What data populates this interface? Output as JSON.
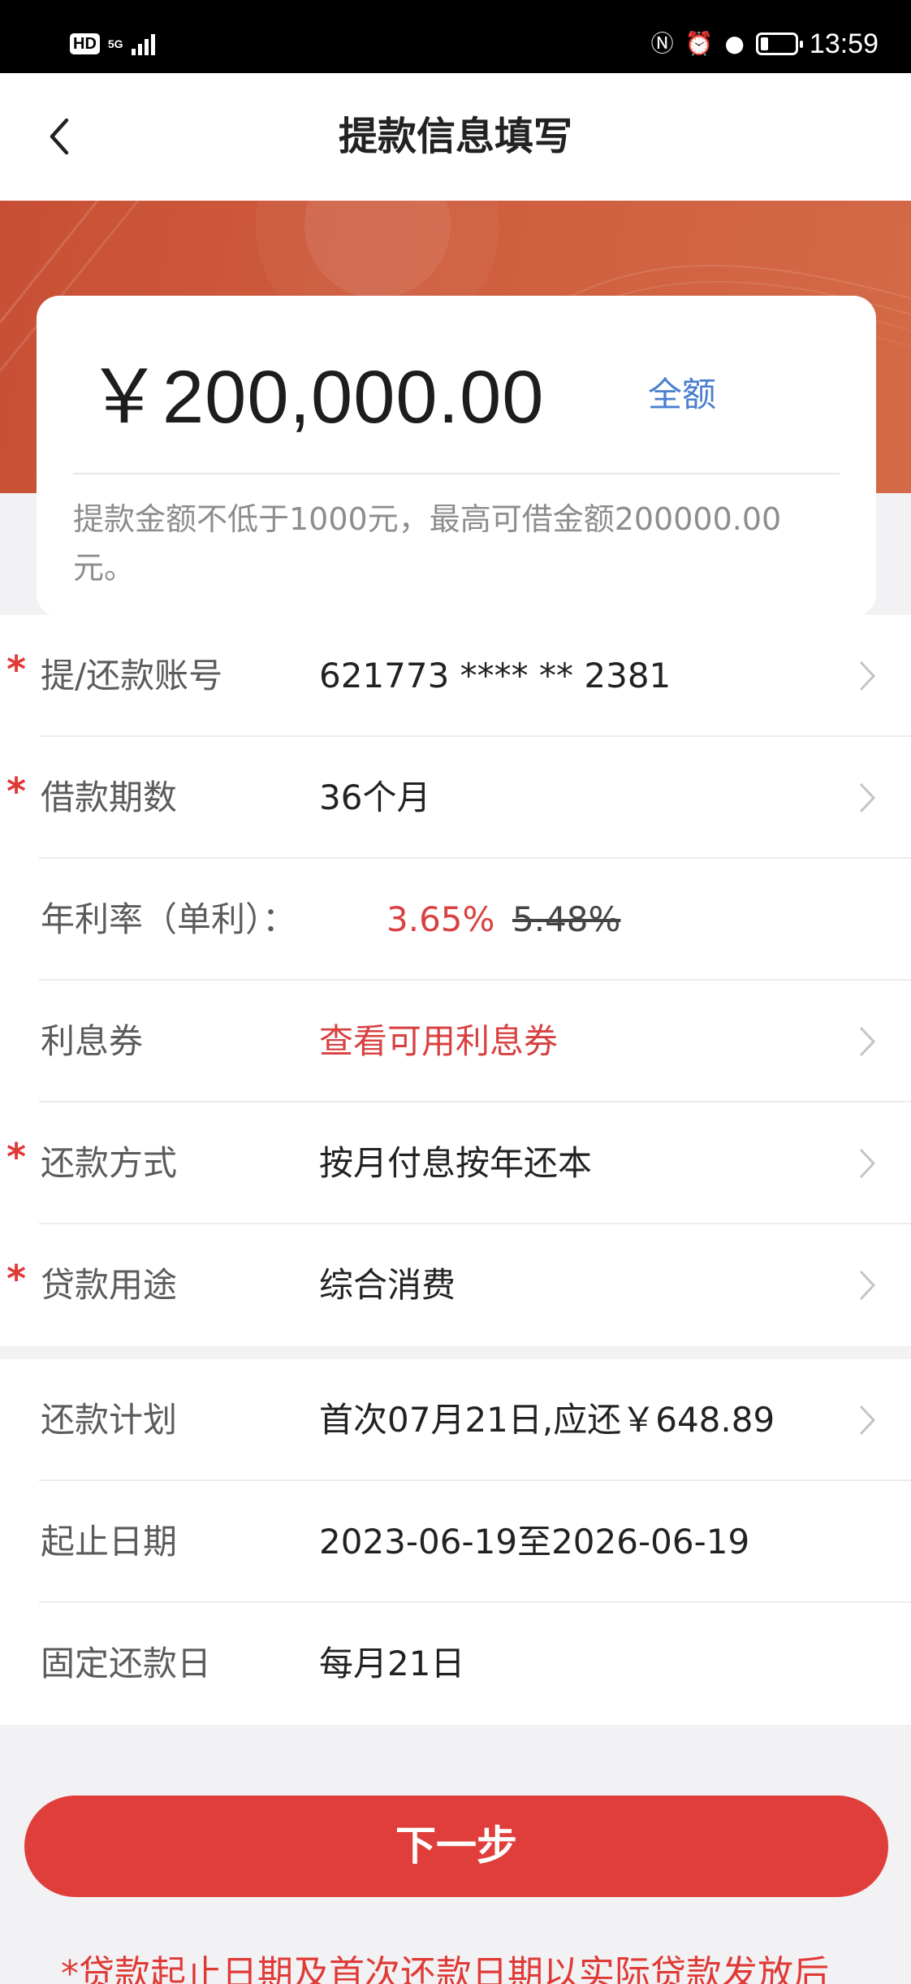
{
  "status_bar": {
    "hd": "HD",
    "network": "5G",
    "time": "13:59",
    "icons": [
      "nfc-icon",
      "alarm-icon",
      "location-icon",
      "battery-icon"
    ]
  },
  "header": {
    "title": "提款信息填写",
    "back_icon": "chevron-left-icon"
  },
  "amount": {
    "value": "￥200,000.00",
    "full_label": "全额",
    "hint": "提款金额不低于1000元，最高可借金额200000.00元。"
  },
  "form": {
    "account": {
      "label": "提/还款账号",
      "value": "621773 **** ** 2381",
      "required": "*"
    },
    "term": {
      "label": "借款期数",
      "value": "36个月",
      "required": "*"
    },
    "rate": {
      "label": "年利率（单利）：",
      "current": "3.65%",
      "original": "5.48%"
    },
    "coupon": {
      "label": "利息券",
      "value": "查看可用利息券"
    },
    "repay_method": {
      "label": "还款方式",
      "value": "按月付息按年还本",
      "required": "*"
    },
    "purpose": {
      "label": "贷款用途",
      "value": "综合消费",
      "required": "*"
    }
  },
  "plan": {
    "schedule": {
      "label": "还款计划",
      "value": "首次07月21日,应还￥648.89"
    },
    "dates": {
      "label": "起止日期",
      "value": "2023-06-19至2026-06-19"
    },
    "fixed_day": {
      "label": "固定还款日",
      "value": "每月21日"
    }
  },
  "next_button": "下一步",
  "footer_note": "*贷款起止日期及首次还款日期以实际贷款发放后",
  "colors": {
    "accent_red": "#e03e3a",
    "link_blue": "#4a7fcf",
    "banner": "#c84f35"
  }
}
